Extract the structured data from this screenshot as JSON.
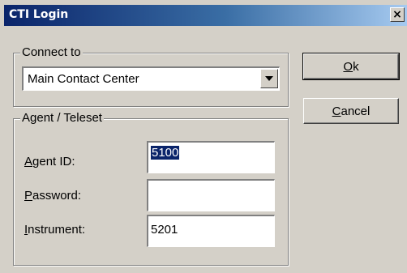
{
  "window": {
    "title": "CTI Login",
    "close_glyph": "×"
  },
  "connect_group": {
    "label": "Connect to",
    "selected": "Main Contact Center"
  },
  "agent_group": {
    "label": "Agent / Teleset",
    "fields": {
      "agent_id": {
        "label_first": "A",
        "label_rest": "gent ID:",
        "value": "5100"
      },
      "password": {
        "label_first": "P",
        "label_rest": "assword:",
        "value": ""
      },
      "instrument": {
        "label_first": "I",
        "label_rest": "nstrument:",
        "value": "5201"
      }
    }
  },
  "buttons": {
    "ok": {
      "first": "O",
      "rest": "k"
    },
    "cancel": {
      "first": "C",
      "rest": "ancel"
    }
  },
  "colors": {
    "title_bar": "#0a246a",
    "dialog_face": "#d4d0c8",
    "selection": "#0a246a"
  }
}
